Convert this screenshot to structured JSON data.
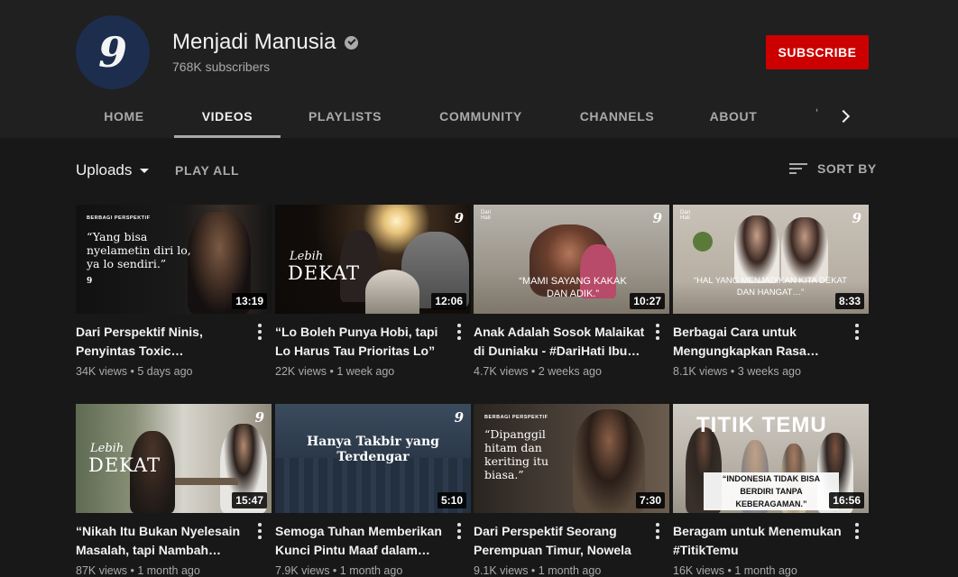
{
  "channel": {
    "name": "Menjadi Manusia",
    "subscribers": "768K subscribers",
    "avatar_text": "9",
    "subscribe_label": "SUBSCRIBE"
  },
  "tabs": [
    {
      "label": "HOME"
    },
    {
      "label": "VIDEOS"
    },
    {
      "label": "PLAYLISTS"
    },
    {
      "label": "COMMUNITY"
    },
    {
      "label": "CHANNELS"
    },
    {
      "label": "ABOUT"
    }
  ],
  "active_tab": "VIDEOS",
  "filter": {
    "uploads_label": "Uploads",
    "play_all_label": "PLAY ALL",
    "sort_label": "SORT BY"
  },
  "videos": [
    {
      "title": "Dari Perspektif Ninis, Penyintas Toxic…",
      "views": "34K views",
      "age": "5 days ago",
      "duration": "13:19",
      "overlay_small": "BERBAGI PERSPEKTIF",
      "overlay": "“Yang bisa nyelametin diri lo, ya lo sendiri.”"
    },
    {
      "title": "“Lo Boleh Punya Hobi, tapi Lo Harus Tau Prioritas Lo” …",
      "views": "22K views",
      "age": "1 week ago",
      "duration": "12:06",
      "overlay_small": "Lebih",
      "overlay": "DEKAT"
    },
    {
      "title": "Anak Adalah Sosok Malaikat di Duniaku - #DariHati Ibu…",
      "views": "4.7K views",
      "age": "2 weeks ago",
      "duration": "10:27",
      "overlay_small": "Dari Hati",
      "overlay": "“MAMI SAYANG KAKAK DAN ADIK.”"
    },
    {
      "title": "Berbagai Cara untuk Mengungkapkan Rasa…",
      "views": "8.1K views",
      "age": "3 weeks ago",
      "duration": "8:33",
      "overlay_small": "Dari Hati",
      "overlay": "“HAL YANG MENJADIKAN KITA DEKAT DAN HANGAT…”"
    },
    {
      "title": "“Nikah Itu Bukan Nyelesain Masalah, tapi Nambah…",
      "views": "87K views",
      "age": "1 month ago",
      "duration": "15:47",
      "overlay_small": "Lebih",
      "overlay": "DEKAT"
    },
    {
      "title": "Semoga Tuhan Memberikan Kunci Pintu Maaf dalam…",
      "views": "7.9K views",
      "age": "1 month ago",
      "duration": "5:10",
      "overlay_small": "",
      "overlay": "Hanya Takbir yang Terdengar"
    },
    {
      "title": "Dari Perspektif Seorang Perempuan Timur, Nowela …",
      "views": "9.1K views",
      "age": "1 month ago",
      "duration": "7:30",
      "overlay_small": "BERBAGI PERSPEKTIF",
      "overlay": "“Dipanggil hitam dan keriting itu biasa.”"
    },
    {
      "title": "Beragam untuk Menemukan #TitikTemu",
      "views": "16K views",
      "age": "1 month ago",
      "duration": "16:56",
      "overlay_small": "TITIK TEMU",
      "overlay": "“INDONESIA TIDAK BISA BERDIRI TANPA KEBERAGAMAN.”"
    }
  ],
  "colors": {
    "header_bg": "#202020",
    "page_bg": "#181818",
    "subscribe_red": "#cc0000",
    "avatar_navy": "#1c2d4d"
  }
}
